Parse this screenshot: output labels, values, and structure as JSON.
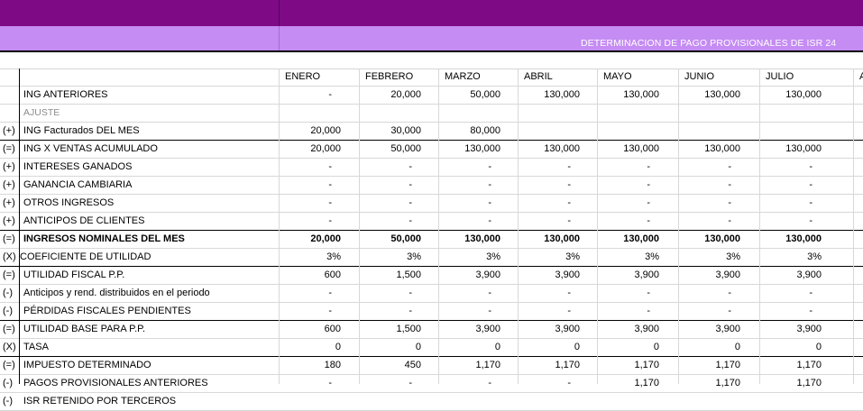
{
  "banner": {
    "title": "DETERMINACION DE PAGO PROVISIONALES DE ISR 24"
  },
  "months": [
    "ENERO",
    "FEBRERO",
    "MARZO",
    "ABRIL",
    "MAYO",
    "JUNIO",
    "JULIO",
    "A"
  ],
  "rows": [
    {
      "sign": "",
      "label": "ING ANTERIORES",
      "style": "normal",
      "values": [
        "-",
        "20,000",
        "50,000",
        "130,000",
        "130,000",
        "130,000",
        "130,000"
      ]
    },
    {
      "sign": "",
      "label": "AJUSTE",
      "style": "gray",
      "values": [
        "",
        "",
        "",
        "",
        "",
        "",
        ""
      ]
    },
    {
      "sign": "(+)",
      "label": "ING Facturados  DEL MES",
      "style": "normal",
      "values": [
        "20,000",
        "30,000",
        "80,000",
        "",
        "",
        "",
        ""
      ]
    },
    {
      "sign": "(=)",
      "label": "ING X VENTAS ACUMULADO",
      "style": "normal",
      "values": [
        "20,000",
        "50,000",
        "130,000",
        "130,000",
        "130,000",
        "130,000",
        "130,000"
      ]
    },
    {
      "sign": "(+)",
      "label": "INTERESES GANADOS",
      "style": "normal",
      "values": [
        "-",
        "-",
        "-",
        "-",
        "-",
        "-",
        "-"
      ]
    },
    {
      "sign": "(+)",
      "label": "GANANCIA CAMBIARIA",
      "style": "normal",
      "values": [
        "-",
        "-",
        "-",
        "-",
        "-",
        "-",
        "-"
      ]
    },
    {
      "sign": "(+)",
      "label": "OTROS INGRESOS",
      "style": "normal",
      "values": [
        "-",
        "-",
        "-",
        "-",
        "-",
        "-",
        "-"
      ]
    },
    {
      "sign": "(+)",
      "label": "ANTICIPOS DE CLIENTES",
      "style": "normal",
      "values": [
        "-",
        "-",
        "-",
        "-",
        "-",
        "-",
        "-"
      ]
    },
    {
      "sign": "(=)",
      "label": "INGRESOS NOMINALES DEL MES",
      "style": "bold",
      "values": [
        "20,000",
        "50,000",
        "130,000",
        "130,000",
        "130,000",
        "130,000",
        "130,000"
      ]
    },
    {
      "sign": "(X)",
      "label": "COEFICIENTE DE UTILIDAD",
      "style": "normal",
      "values": [
        "3%",
        "3%",
        "3%",
        "3%",
        "3%",
        "3%",
        "3%"
      ]
    },
    {
      "sign": "(=)",
      "label": "UTILIDAD FISCAL P.P.",
      "style": "normal",
      "values": [
        "600",
        "1,500",
        "3,900",
        "3,900",
        "3,900",
        "3,900",
        "3,900"
      ]
    },
    {
      "sign": "(-)",
      "label": "Anticipos y rend. distribuidos en el periodo",
      "style": "normal",
      "values": [
        "-",
        "-",
        "-",
        "-",
        "-",
        "-",
        "-"
      ]
    },
    {
      "sign": "(-)",
      "label": "PÉRDIDAS FISCALES PENDIENTES",
      "style": "normal",
      "values": [
        "-",
        "-",
        "-",
        "-",
        "-",
        "-",
        "-"
      ]
    },
    {
      "sign": "(=)",
      "label": "UTILIDAD BASE PARA P.P.",
      "style": "normal",
      "values": [
        "600",
        "1,500",
        "3,900",
        "3,900",
        "3,900",
        "3,900",
        "3,900"
      ]
    },
    {
      "sign": "(X)",
      "label": "TASA",
      "style": "normal",
      "values": [
        "0",
        "0",
        "0",
        "0",
        "0",
        "0",
        "0"
      ]
    },
    {
      "sign": "(=)",
      "label": "IMPUESTO DETERMINADO",
      "style": "normal",
      "values": [
        "180",
        "450",
        "1,170",
        "1,170",
        "1,170",
        "1,170",
        "1,170"
      ]
    },
    {
      "sign": "(-)",
      "label": "PAGOS PROVISIONALES ANTERIORES",
      "style": "normal",
      "values": [
        "-",
        "-",
        "-",
        "-",
        "1,170",
        "1,170",
        "1,170"
      ]
    },
    {
      "sign": "(-)",
      "label": "ISR RETENIDO POR TERCEROS",
      "style": "normal",
      "values": [
        "",
        "",
        "",
        "",
        "",
        "",
        ""
      ]
    }
  ]
}
